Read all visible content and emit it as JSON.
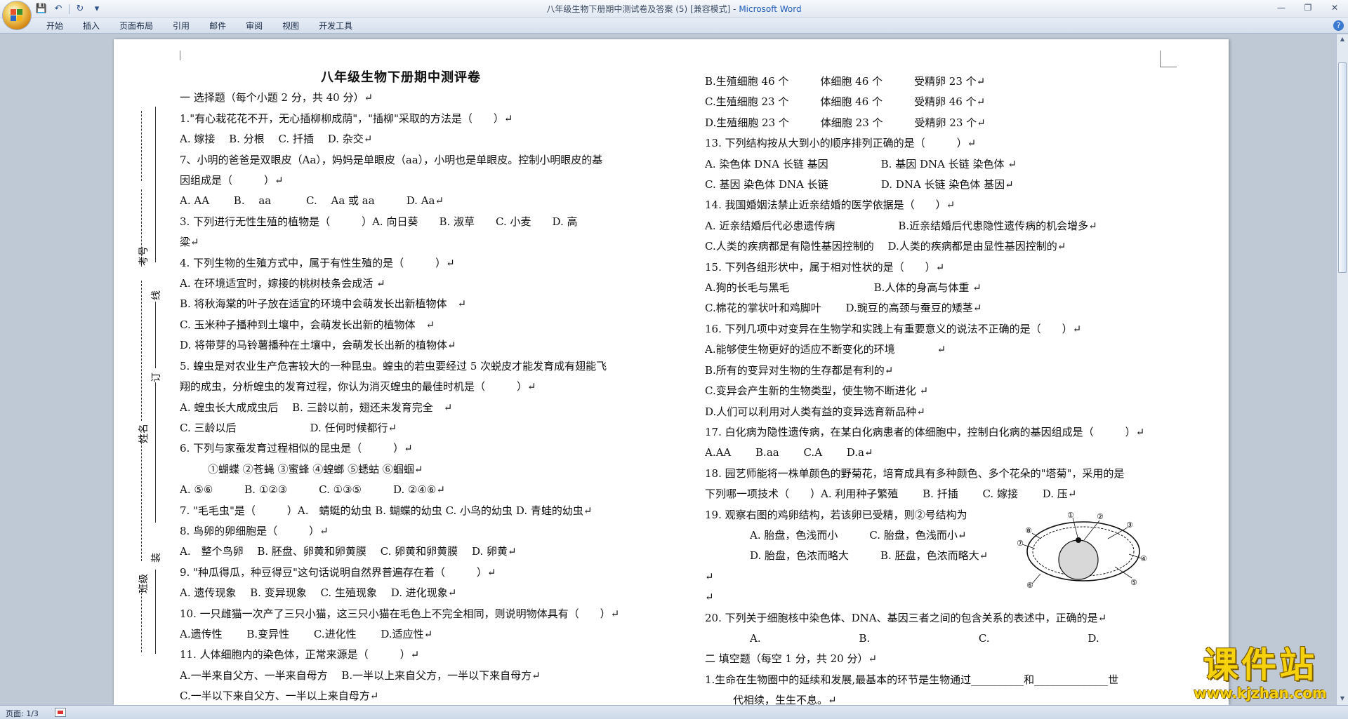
{
  "window": {
    "title": "八年级生物下册期中测试卷及答案 (5) [兼容模式] - ",
    "app_name": "Microsoft Word"
  },
  "ribbon": {
    "tabs": [
      "开始",
      "插入",
      "页面布局",
      "引用",
      "邮件",
      "审阅",
      "视图",
      "开发工具"
    ]
  },
  "statusbar": {
    "page": "页面: 1/3"
  },
  "margin": {
    "label_exam_no": "考号",
    "label_line": "线",
    "label_ding": "订",
    "label_name": "姓名",
    "label_zhuang": "装",
    "label_class": "班级"
  },
  "doc": {
    "title": "八年级生物下册期中测评卷",
    "left": [
      {
        "t": "一 选择题（每个小题 2 分，共 40 分）↵"
      },
      {
        "t": "1.\"有心栽花花不开，无心插柳柳成荫\"，\"插柳\"采取的方法是（　　）↵"
      },
      {
        "t": "A. 嫁接　 B. 分根　 C. 扦插　 D. 杂交↵"
      },
      {
        "t": "7、小明的爸爸是双眼皮（Aa），妈妈是单眼皮（aa），小明也是单眼皮。控制小明眼皮的基"
      },
      {
        "t": "因组成是（　　　）↵"
      },
      {
        "t": "A. AA　　 B.　 aa　　　 C.　 Aa 或 aa　　　D. Aa↵"
      },
      {
        "t": "3. 下列进行无性生殖的植物是（　　　）A. 向日葵　　B. 淑草　　C. 小麦　　D. 高"
      },
      {
        "t": "粱↵"
      },
      {
        "t": "4. 下列生物的生殖方式中，属于有性生殖的是（　　　）↵"
      },
      {
        "t": "A. 在环境适宜时，嫁接的桃树枝条会成活 ↵"
      },
      {
        "t": "B. 将秋海棠的叶子放在适宜的环境中会萌发长出新植物体　↵"
      },
      {
        "t": "C. 玉米种子播种到土壤中，会萌发长出新的植物体　↵"
      },
      {
        "t": "D. 将带芽的马铃薯播种在土壤中，会萌发长出新的植物体↵"
      },
      {
        "t": "5. 蝗虫是对农业生产危害较大的一种昆虫。蝗虫的若虫要经过 5 次蜕皮才能发育成有翅能飞"
      },
      {
        "t": "翔的成虫，分析蝗虫的发育过程，你认为消灭蝗虫的最佳时机是（　　　）↵"
      },
      {
        "t": "A. 蝗虫长大成成虫后　 B. 三龄以前，翅还未发育完全　↵"
      },
      {
        "t": "C. 三龄以后　　　　　　　D. 任何时候都行↵"
      },
      {
        "t": "6. 下列与家蚕发育过程相似的昆虫是（　　　）↵"
      },
      {
        "t": "①蝴蝶 ②苍蝇 ③蜜蜂 ④蝗螂 ⑤蟋蛄 ⑥蝈蝈↵",
        "cls": "ind"
      },
      {
        "t": "A. ⑤⑥　　　B. ①②③　　　C. ①③⑤　　　D. ②④⑥↵"
      },
      {
        "t": "7. \"毛毛虫\"是（　　　）A.　蜻蜓的幼虫 B. 蝴蝶的幼虫 C. 小鸟的幼虫 D. 青蛙的幼虫↵"
      },
      {
        "t": "8. 鸟卵的卵细胞是（　　　）↵"
      },
      {
        "t": "A.　整个鸟卵　 B. 胚盘、卵黄和卵黄膜　 C. 卵黄和卵黄膜　 D. 卵黄↵"
      },
      {
        "t": "9. \"种瓜得瓜，种豆得豆\"这句话说明自然界普遍存在着（　　　）↵"
      },
      {
        "t": "A. 遗传现象　 B. 变异现象　 C. 生殖现象　 D. 进化现象↵"
      },
      {
        "t": "10. 一只雌猫一次产了三只小猫，这三只小猫在毛色上不完全相同，则说明物体具有（　　）↵"
      },
      {
        "t": "A.遗传性　　 B.变异性　　 C.进化性　　 D.适应性↵"
      },
      {
        "t": "11. 人体细胞内的染色体，正常来源是（　　　）↵"
      },
      {
        "t": "A.一半来自父方、一半来自母方　 B.一半以上来自父方，一半以下来自母方↵"
      },
      {
        "t": "C.一半以下来自父方、一半以上来自母方↵"
      }
    ],
    "right": [
      {
        "t": "B.生殖细胞 46 个　　　体细胞 46 个　　　受精卵 23 个↵"
      },
      {
        "t": "C.生殖细胞 23 个　　　体细胞 46 个　　　受精卵 46 个↵"
      },
      {
        "t": "D.生殖细胞 23 个　　　体细胞 23 个　　　受精卵 23 个↵"
      },
      {
        "t": "13. 下列结构按从大到小的顺序排列正确的是（　　　）↵"
      },
      {
        "t": "A. 染色体 DNA 长链 基因　　　　　B. 基因 DNA 长链 染色体 ↵"
      },
      {
        "t": "C. 基因 染色体 DNA 长链　　　　　D. DNA 长链 染色体 基因↵"
      },
      {
        "t": "14. 我国婚姻法禁止近亲结婚的医学依据是（　　）↵"
      },
      {
        "t": "A. 近亲结婚后代必患遗传病　　　　　　B.近亲结婚后代患隐性遗传病的机会增多↵"
      },
      {
        "t": "C.人类的疾病都是有隐性基因控制的　 D.人类的疾病都是由显性基因控制的↵"
      },
      {
        "t": "15. 下列各组形状中，属于相对性状的是（　　）↵"
      },
      {
        "t": "A.狗的长毛与黑毛　　　　　　　　B.人体的身高与体重 ↵"
      },
      {
        "t": "C.棉花的掌状叶和鸡脚叶　　 D.豌豆的高颈与蚕豆的矮茎↵"
      },
      {
        "t": "16. 下列几项中对变异在生物学和实践上有重要意义的说法不正确的是（　　）↵"
      },
      {
        "t": "A.能够使生物更好的适应不断变化的环境　　　　↵"
      },
      {
        "t": "B.所有的变异对生物的生存都是有利的↵"
      },
      {
        "t": "C.变异会产生新的生物类型，使生物不断进化 ↵"
      },
      {
        "t": "D.人们可以利用对人类有益的变异选育新品种↵"
      },
      {
        "t": "17. 白化病为隐性遗传病，在某白化病患者的体细胞中，控制白化病的基因组成是（　　　）↵"
      },
      {
        "t": "A.AA　　 B.aa　　 C.A　　 D.a↵"
      },
      {
        "t": "18. 园艺师能将一株单颜色的野菊花，培育成具有多种颜色、多个花朵的\"塔菊\"，采用的是"
      },
      {
        "t": "下列哪一项技术（　　）A. 利用种子繁殖　　 B. 扦插　　 C. 嫁接　　 D. 压↵"
      },
      {
        "t": "19. 观察右图的鸡卵结构，若该卵已受精，则②号结构为"
      },
      {
        "t": "A. 胎盘，色浅而小　　　C. 胎盘，色浅而小↵",
        "cls": "ind2"
      },
      {
        "t": "D. 胎盘，色浓而略大　　　B. 胚盘，色浓而略大↵",
        "cls": "ind2"
      },
      {
        "t": "↵"
      },
      {
        "t": "↵"
      },
      {
        "t": "20. 下列关于细胞核中染色体、DNA、基因三者之间的包含关系的表述中，正确的是↵"
      },
      {
        "t": "A.　　　　　　　　　 B.　　　　　　　　　　 C.　　　　　　　　　 D.",
        "cls": "ind2"
      },
      {
        "t": "二 填空题（每空 1 分，共 20 分）↵"
      },
      {
        "t": "1.生命在生物圈中的延续和发展,最基本的环节是生物通过__________和______________世"
      },
      {
        "t": "代相续，生生不息。↵",
        "cls": "ind"
      }
    ],
    "egg_labels": [
      "①",
      "②",
      "③",
      "④",
      "⑤",
      "⑥",
      "⑦",
      "⑧"
    ]
  },
  "watermark": {
    "big": "课件站",
    "small": "www.kjzhan.com"
  }
}
